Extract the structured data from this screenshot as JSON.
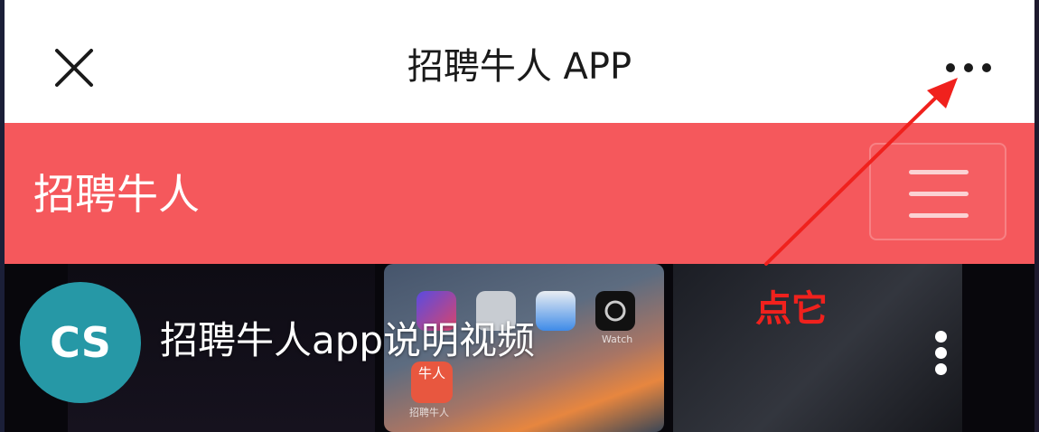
{
  "topbar": {
    "title": "招聘牛人 APP",
    "close_icon": "close-icon",
    "more_icon": "more-horizontal-icon"
  },
  "site_header": {
    "brand": "招聘牛人",
    "menu_icon": "hamburger-menu-icon",
    "background_color": "#f5585c"
  },
  "video": {
    "avatar_text": "CS",
    "avatar_color": "#2698a6",
    "title": "招聘牛人app说明视频",
    "more_icon": "more-vertical-icon",
    "screen": {
      "watch_label": "Watch",
      "app_icon_text": "牛人",
      "app_icon_label": "招聘牛人"
    }
  },
  "annotation": {
    "text": "点它",
    "color": "#f0211d"
  }
}
